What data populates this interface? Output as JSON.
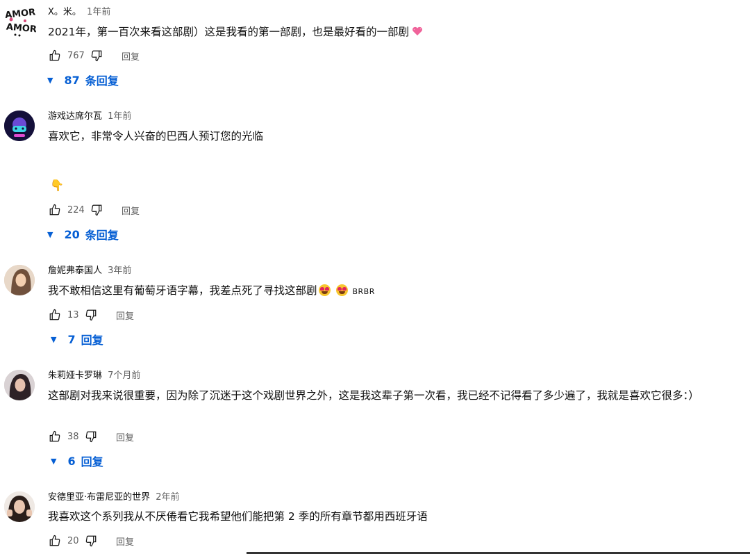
{
  "comments": [
    {
      "author": "X。米。",
      "time": "1年前",
      "avatar_text": [
        "AMOR",
        "AMOR"
      ],
      "text": "2021年，第一百次来看这部剧）这是我看的第一部剧，也是最好看的一部剧",
      "likes": "767",
      "reply_label": "回复",
      "replies_count": "87",
      "replies_suffix": "条回复"
    },
    {
      "author": "游戏达席尔瓦",
      "time": "1年前",
      "text": "喜欢它，非常令人兴奋的巴西人预订您的光临",
      "emoji": "👇",
      "likes": "224",
      "reply_label": "回复",
      "replies_count": "20",
      "replies_suffix": "条回复"
    },
    {
      "author": "詹妮弗泰国人",
      "time": "3年前",
      "text": "我不敢相信这里有葡萄牙语字幕，我差点死了寻找这部剧",
      "text_suffix": "BRBR",
      "likes": "13",
      "reply_label": "回复",
      "replies_count": "7",
      "replies_suffix": "回复"
    },
    {
      "author": "朱莉娅卡罗琳",
      "time": "7个月前",
      "text": "这部剧对我来说很重要，因为除了沉迷于这个戏剧世界之外，这是我这辈子第一次看，我已经不记得看了多少遍了，我就是喜欢它很多：）",
      "likes": "38",
      "reply_label": "回复",
      "replies_count": "6",
      "replies_suffix": "回复"
    },
    {
      "author": "安德里亚·布雷尼亚的世界",
      "time": "2年前",
      "text": "我喜欢这个系列我从不厌倦看它我希望他们能把第 2 季的所有章节都用西班牙语",
      "likes": "20",
      "reply_label": "回复"
    }
  ],
  "colors": {
    "link_blue": "#065fd4",
    "meta_gray": "#606060"
  }
}
